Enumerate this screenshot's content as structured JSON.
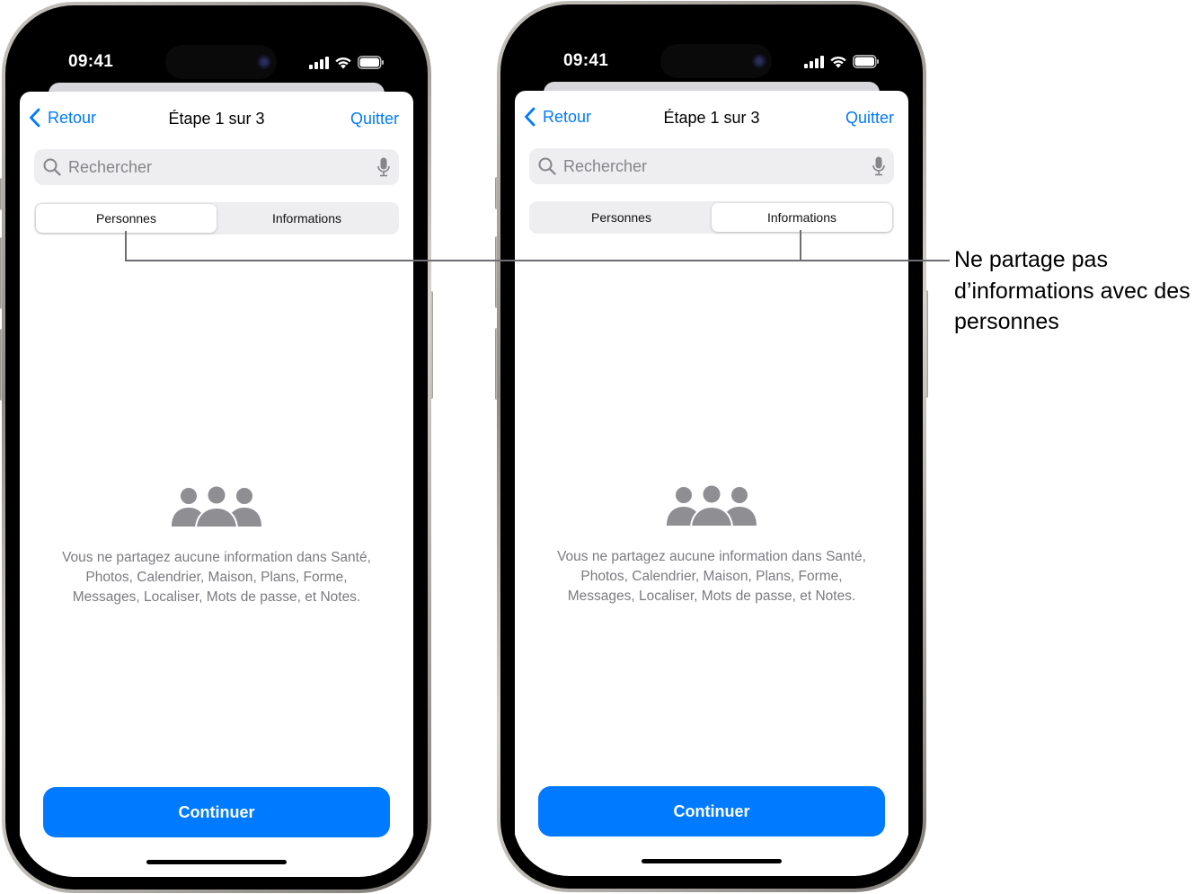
{
  "phones": [
    {
      "status_bar": {
        "time": "09:41",
        "icons": [
          "cellular-signal-icon",
          "wifi-icon",
          "battery-icon"
        ]
      },
      "nav": {
        "back_label": "Retour",
        "title": "Étape 1 sur 3",
        "quit_label": "Quitter"
      },
      "search": {
        "placeholder": "Rechercher",
        "value": ""
      },
      "segments": [
        {
          "label": "Personnes",
          "selected": true
        },
        {
          "label": "Informations",
          "selected": false
        }
      ],
      "empty_state": {
        "icon": "people-group-icon",
        "message": "Vous ne partagez aucune information dans Santé, Photos, Calendrier, Maison, Plans, Forme, Messages, Localiser, Mots de passe, et Notes."
      },
      "continue_label": "Continuer"
    },
    {
      "status_bar": {
        "time": "09:41",
        "icons": [
          "cellular-signal-icon",
          "wifi-icon",
          "battery-icon"
        ]
      },
      "nav": {
        "back_label": "Retour",
        "title": "Étape 1 sur 3",
        "quit_label": "Quitter"
      },
      "search": {
        "placeholder": "Rechercher",
        "value": ""
      },
      "segments": [
        {
          "label": "Personnes",
          "selected": false
        },
        {
          "label": "Informations",
          "selected": true
        }
      ],
      "empty_state": {
        "icon": "people-group-icon",
        "message": "Vous ne partagez aucune information dans Santé, Photos, Calendrier, Maison, Plans, Forme, Messages, Localiser, Mots de passe, et Notes."
      },
      "continue_label": "Continuer"
    }
  ],
  "callout": {
    "text": "Ne partage pas d’informations avec des personnes"
  },
  "colors": {
    "accent": "#007aff",
    "secondary_text": "#7b7b80",
    "segment_bg": "#eeeef0",
    "icon_gray": "#8e8e93"
  }
}
